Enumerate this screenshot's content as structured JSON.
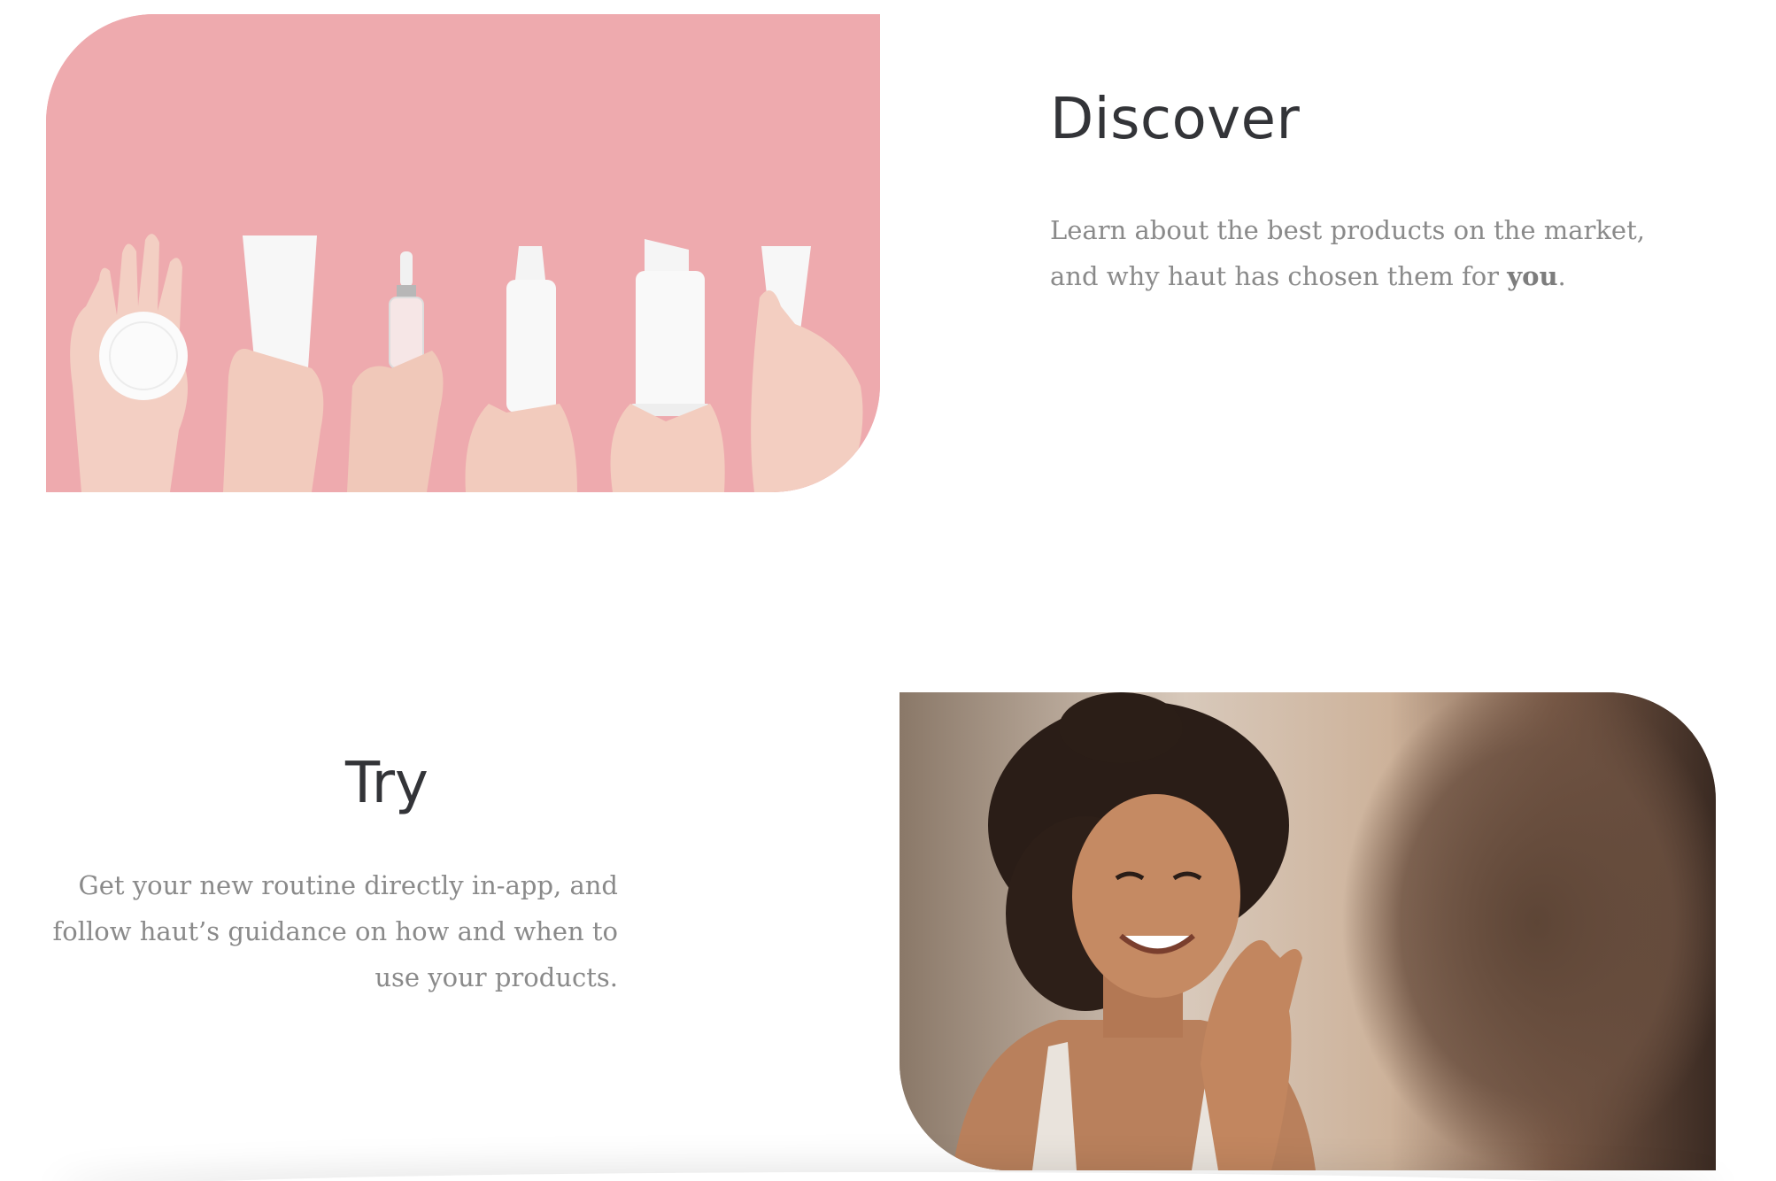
{
  "discover": {
    "title": "Discover",
    "text_before": "Learn about the best products on the market, and why haut has chosen them for ",
    "text_emphasis": "you",
    "text_after": ".",
    "image_background_color": "#eeaaae"
  },
  "try": {
    "title": "Try",
    "text": "Get your new routine directly in-app, and follow haut’s guidance on how and when to use your products."
  },
  "colors": {
    "heading": "#333438",
    "body_text": "#8a8a8a",
    "page_background": "#ffffff"
  }
}
